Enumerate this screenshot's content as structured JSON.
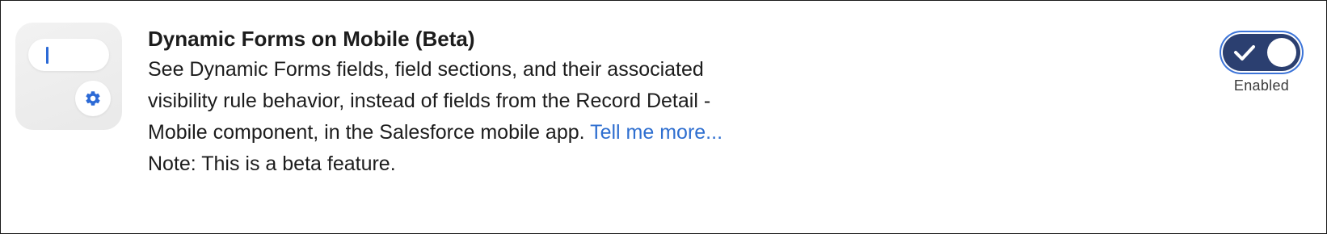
{
  "feature": {
    "title": "Dynamic Forms on Mobile (Beta)",
    "description": "See Dynamic Forms fields, field sections, and their associated visibility rule behavior, instead of fields from the Record Detail - Mobile component, in the Salesforce mobile app.",
    "link_text": "Tell me more...",
    "note": "Note: This is a beta feature."
  },
  "toggle": {
    "state": "on",
    "label": "Enabled"
  },
  "icons": {
    "tile": "dynamic-forms-illustration",
    "tile_gear": "gear-icon",
    "toggle_check": "checkmark-icon"
  },
  "colors": {
    "link": "#2f6fd0",
    "toggle_track": "#2b3f70",
    "focus_ring": "#3c74d8",
    "accent": "#2c6ad6"
  }
}
